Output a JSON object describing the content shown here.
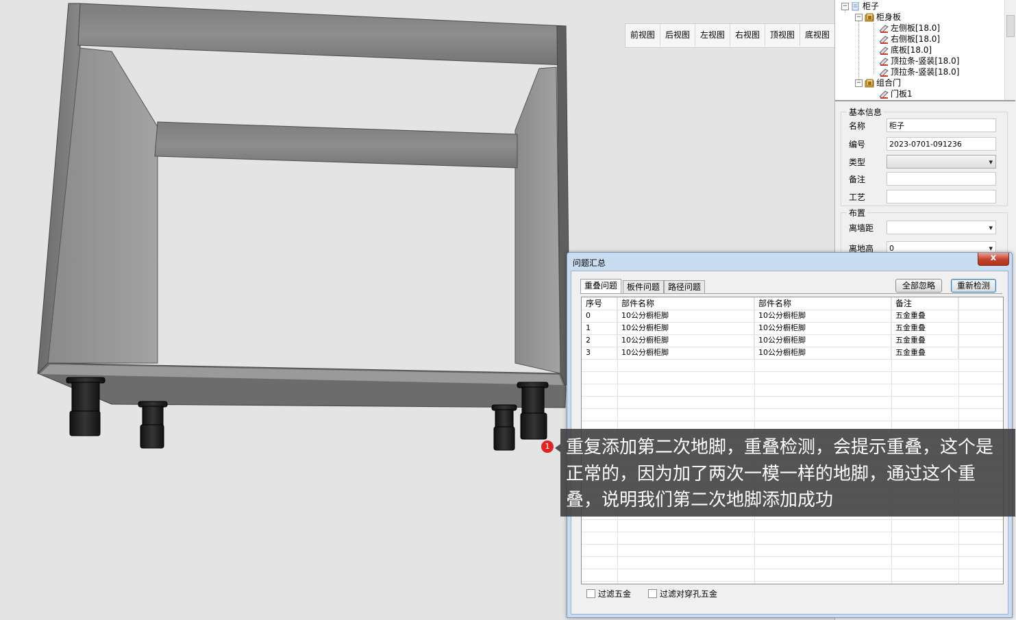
{
  "view_buttons": [
    "前视图",
    "后视图",
    "左视图",
    "右视图",
    "顶视图",
    "底视图"
  ],
  "tree": {
    "root": "柜子",
    "body": "柜身板",
    "body_items": [
      "左侧板[18.0]",
      "右侧板[18.0]",
      "底板[18.0]",
      "顶拉条-竖装[18.0]",
      "顶拉条-竖装[18.0]"
    ],
    "door_group": "组合门",
    "door_items": [
      "门板1"
    ]
  },
  "basic_info": {
    "legend": "基本信息",
    "name_label": "名称",
    "name_value": "柜子",
    "code_label": "编号",
    "code_value": "2023-0701-091236",
    "type_label": "类型",
    "type_value": "",
    "remark_label": "备注",
    "remark_value": "",
    "process_label": "工艺",
    "process_value": ""
  },
  "layout": {
    "legend": "布置",
    "wall_label": "离墙距",
    "wall_value": "",
    "floor_label": "离地高",
    "floor_value": "0"
  },
  "dialog": {
    "title": "问题汇总",
    "close": "x",
    "tabs": [
      "重叠问题",
      "板件问题",
      "路径问题"
    ],
    "ignore_all": "全部忽略",
    "recheck": "重新检测",
    "columns": [
      "序号",
      "部件名称",
      "部件名称",
      "备注"
    ],
    "rows": [
      [
        "0",
        "10公分橱柜脚",
        "10公分橱柜脚",
        "五金重叠"
      ],
      [
        "1",
        "10公分橱柜脚",
        "10公分橱柜脚",
        "五金重叠"
      ],
      [
        "2",
        "10公分橱柜脚",
        "10公分橱柜脚",
        "五金重叠"
      ],
      [
        "3",
        "10公分橱柜脚",
        "10公分橱柜脚",
        "五金重叠"
      ]
    ],
    "filter_hardware": "过滤五金",
    "filter_through_hole": "过滤对穿孔五金"
  },
  "annotation": {
    "badge": "1",
    "text": "重复添加第二次地脚，重叠检测，会提示重叠，这个是正常的，因为加了两次一模一样的地脚，通过这个重叠，说明我们第二次地脚添加成功"
  }
}
